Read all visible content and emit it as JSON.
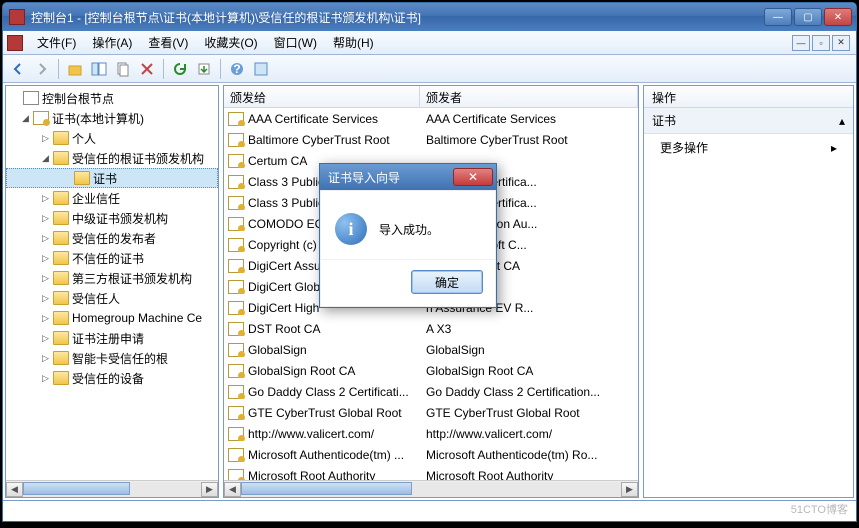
{
  "title": "控制台1 - [控制台根节点\\证书(本地计算机)\\受信任的根证书颁发机构\\证书]",
  "menu": [
    "文件(F)",
    "操作(A)",
    "查看(V)",
    "收藏夹(O)",
    "窗口(W)",
    "帮助(H)"
  ],
  "tree": {
    "root": "控制台根节点",
    "certRoot": "证书(本地计算机)",
    "items": [
      "个人",
      "受信任的根证书颁发机构",
      "证书",
      "企业信任",
      "中级证书颁发机构",
      "受信任的发布者",
      "不信任的证书",
      "第三方根证书颁发机构",
      "受信任人",
      "Homegroup Machine Ce",
      "证书注册申请",
      "智能卡受信任的根",
      "受信任的设备"
    ]
  },
  "list": {
    "cols": [
      "颁发给",
      "颁发者"
    ],
    "rows": [
      [
        "AAA Certificate Services",
        "AAA Certificate Services"
      ],
      [
        "Baltimore CyberTrust Root",
        "Baltimore CyberTrust Root"
      ],
      [
        "Certum CA",
        ""
      ],
      [
        "Class 3 Public",
        "ic Primary Certifica..."
      ],
      [
        "Class 3 Public",
        "ic Primary Certifica..."
      ],
      [
        "COMODO EC",
        "CC Certification Au..."
      ],
      [
        "Copyright (c)",
        "1997 Microsoft C..."
      ],
      [
        "DigiCert Assu",
        "sured ID Root CA"
      ],
      [
        "DigiCert Glob",
        "bal Root CA"
      ],
      [
        "DigiCert High",
        "h Assurance EV R..."
      ],
      [
        "DST Root CA",
        "A X3"
      ],
      [
        "GlobalSign",
        "GlobalSign"
      ],
      [
        "GlobalSign Root CA",
        "GlobalSign Root CA"
      ],
      [
        "Go Daddy Class 2 Certificati...",
        "Go Daddy Class 2 Certification..."
      ],
      [
        "GTE CyberTrust Global Root",
        "GTE CyberTrust Global Root"
      ],
      [
        "http://www.valicert.com/",
        "http://www.valicert.com/"
      ],
      [
        "Microsoft Authenticode(tm) ...",
        "Microsoft Authenticode(tm) Ro..."
      ],
      [
        "Microsoft Root Authority",
        "Microsoft Root Authority"
      ]
    ]
  },
  "actions": {
    "header": "操作",
    "section": "证书",
    "more": "更多操作"
  },
  "dialog": {
    "title": "证书导入向导",
    "message": "导入成功。",
    "ok": "确定"
  },
  "watermark": "51CTO博客"
}
